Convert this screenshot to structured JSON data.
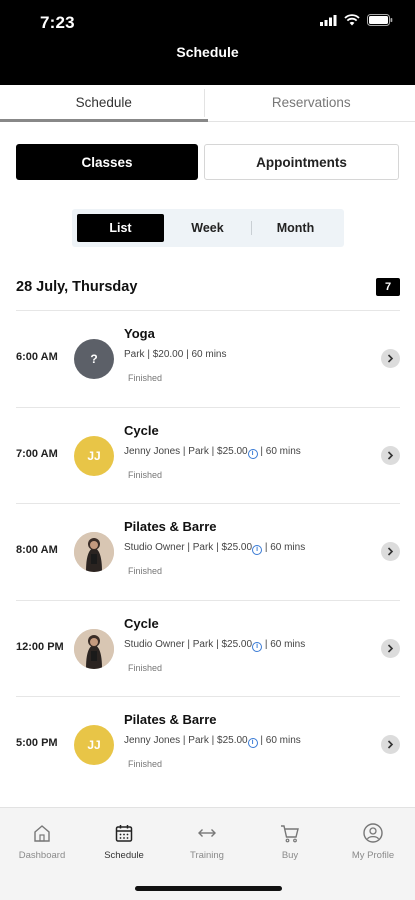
{
  "status_bar": {
    "time": "7:23",
    "icons": [
      "signal-icon",
      "wifi-icon",
      "battery-icon"
    ]
  },
  "header": {
    "title": "Schedule"
  },
  "top_tabs": [
    {
      "label": "Schedule",
      "active": true
    },
    {
      "label": "Reservations",
      "active": false
    }
  ],
  "segments": {
    "classes_label": "Classes",
    "appointments_label": "Appointments"
  },
  "view_toggle": [
    {
      "label": "List",
      "active": true
    },
    {
      "label": "Week",
      "active": false
    },
    {
      "label": "Month",
      "active": false
    }
  ],
  "date": {
    "label": "28 July, Thursday",
    "badge": "7"
  },
  "classes": [
    {
      "time": "6:00 AM",
      "avatar_text": "?",
      "avatar_style": "gray",
      "name": "Yoga",
      "meta": "Park | $20.00 | 60 mins",
      "has_info": false,
      "status": "Finished"
    },
    {
      "time": "7:00 AM",
      "avatar_text": "JJ",
      "avatar_style": "yellow",
      "name": "Cycle",
      "meta_before": "Jenny Jones | Park | $25.00",
      "meta_after": " | 60 mins",
      "has_info": true,
      "status": "Finished"
    },
    {
      "time": "8:00 AM",
      "avatar_text": "",
      "avatar_style": "photo",
      "name": "Pilates & Barre",
      "meta_before": "Studio Owner | Park | $25.00",
      "meta_after": " | 60 mins",
      "has_info": true,
      "status": "Finished"
    },
    {
      "time": "12:00 PM",
      "avatar_text": "",
      "avatar_style": "photo",
      "name": "Cycle",
      "meta_before": "Studio Owner | Park | $25.00",
      "meta_after": " | 60 mins",
      "has_info": true,
      "status": "Finished"
    },
    {
      "time": "5:00 PM",
      "avatar_text": "JJ",
      "avatar_style": "yellow",
      "name": "Pilates & Barre",
      "meta_before": "Jenny Jones | Park | $25.00",
      "meta_after": " | 60 mins",
      "has_info": true,
      "status": "Finished"
    }
  ],
  "bottom_nav": [
    {
      "label": "Dashboard",
      "icon": "home-icon",
      "active": false
    },
    {
      "label": "Schedule",
      "icon": "calendar-icon",
      "active": true
    },
    {
      "label": "Training",
      "icon": "arrows-icon",
      "active": false
    },
    {
      "label": "Buy",
      "icon": "cart-icon",
      "active": false
    },
    {
      "label": "My Profile",
      "icon": "user-icon",
      "active": false
    }
  ],
  "colors": {
    "header_bg": "#000000",
    "accent_yellow": "#e8c547",
    "avatar_gray": "#5c6068",
    "info_blue": "#3a7bd5"
  }
}
